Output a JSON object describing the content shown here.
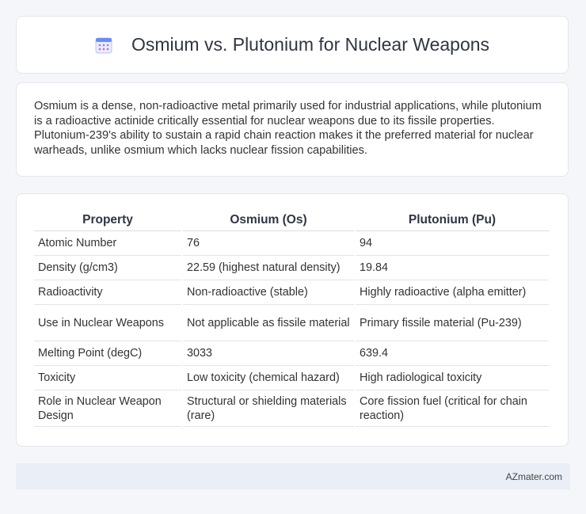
{
  "header": {
    "title": "Osmium vs. Plutonium for Nuclear Weapons",
    "icon": "calendar-icon",
    "icon_colors": {
      "top": "#6c8cf5",
      "body": "#e9ecff",
      "dots": "#c06adf"
    }
  },
  "description": {
    "text": "Osmium is a dense, non-radioactive metal primarily used for industrial applications, while plutonium is a radioactive actinide critically essential for nuclear weapons due to its fissile properties. Plutonium-239's ability to sustain a rapid chain reaction makes it the preferred material for nuclear warheads, unlike osmium which lacks nuclear fission capabilities."
  },
  "table": {
    "headers": [
      "Property",
      "Osmium (Os)",
      "Plutonium (Pu)"
    ],
    "rows": [
      [
        "Atomic Number",
        "76",
        "94"
      ],
      [
        "Density (g/cm3)",
        "22.59 (highest natural density)",
        "19.84"
      ],
      [
        "Radioactivity",
        "Non-radioactive (stable)",
        "Highly radioactive (alpha emitter)"
      ],
      [
        "Use in Nuclear Weapons",
        "Not applicable as fissile material",
        "Primary fissile material (Pu-239)"
      ],
      [
        "Melting Point (degC)",
        "3033",
        "639.4"
      ],
      [
        "Toxicity",
        "Low toxicity (chemical hazard)",
        "High radiological toxicity"
      ],
      [
        "Role in Nuclear Weapon Design",
        "Structural or shielding materials (rare)",
        "Core fission fuel (critical for chain reaction)"
      ]
    ]
  },
  "footer": {
    "text": "AZmater.com"
  }
}
